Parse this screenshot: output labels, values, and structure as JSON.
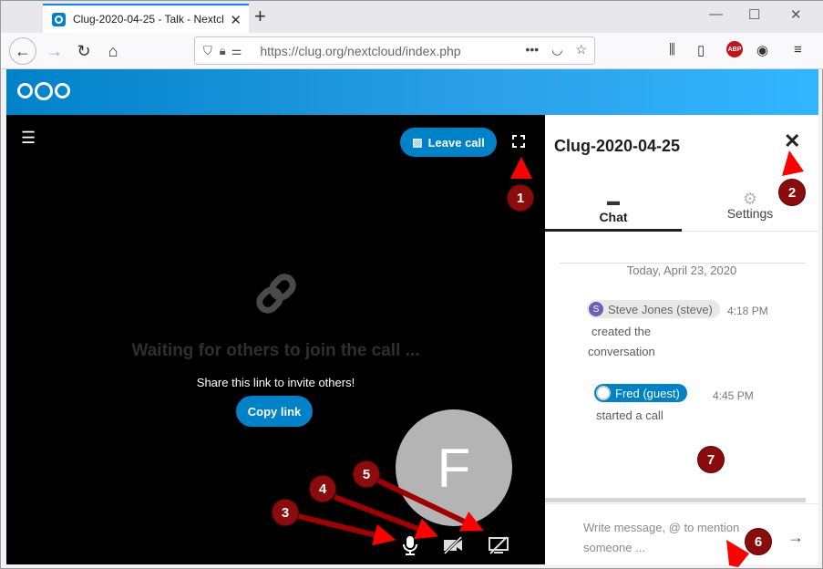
{
  "browser": {
    "tab_title": "Clug-2020-04-25 - Talk - Nextcl",
    "url": "https://clug.org/nextcloud/index.php",
    "abp_label": "ABP"
  },
  "call": {
    "leave_label": "Leave call",
    "waiting_text": "Waiting for others to join the call ...",
    "share_text": "Share this link to invite others!",
    "copy_label": "Copy link",
    "avatar_letter": "F"
  },
  "sidebar": {
    "room_name": "Clug-2020-04-25",
    "tabs": [
      {
        "label": "Chat",
        "icon": "chat-icon"
      },
      {
        "label": "Settings",
        "icon": "gear-icon"
      }
    ],
    "date_separator": "Today, April 23, 2020",
    "messages": [
      {
        "author": "Steve Jones (steve)",
        "avatar_letter": "S",
        "time": "4:18 PM",
        "text_line1": "created the",
        "text_line2": "conversation"
      },
      {
        "author": "Fred (guest)",
        "time": "4:45 PM",
        "text_line1": "started a call"
      }
    ],
    "composer_placeholder_line1": "Write message, @ to mention",
    "composer_placeholder_line2": "someone ..."
  },
  "annotations": [
    "1",
    "2",
    "3",
    "4",
    "5",
    "6",
    "7"
  ],
  "colors": {
    "accent": "#0082c9",
    "annotation": "#8b0c0c",
    "arrow": "#ff0000"
  }
}
